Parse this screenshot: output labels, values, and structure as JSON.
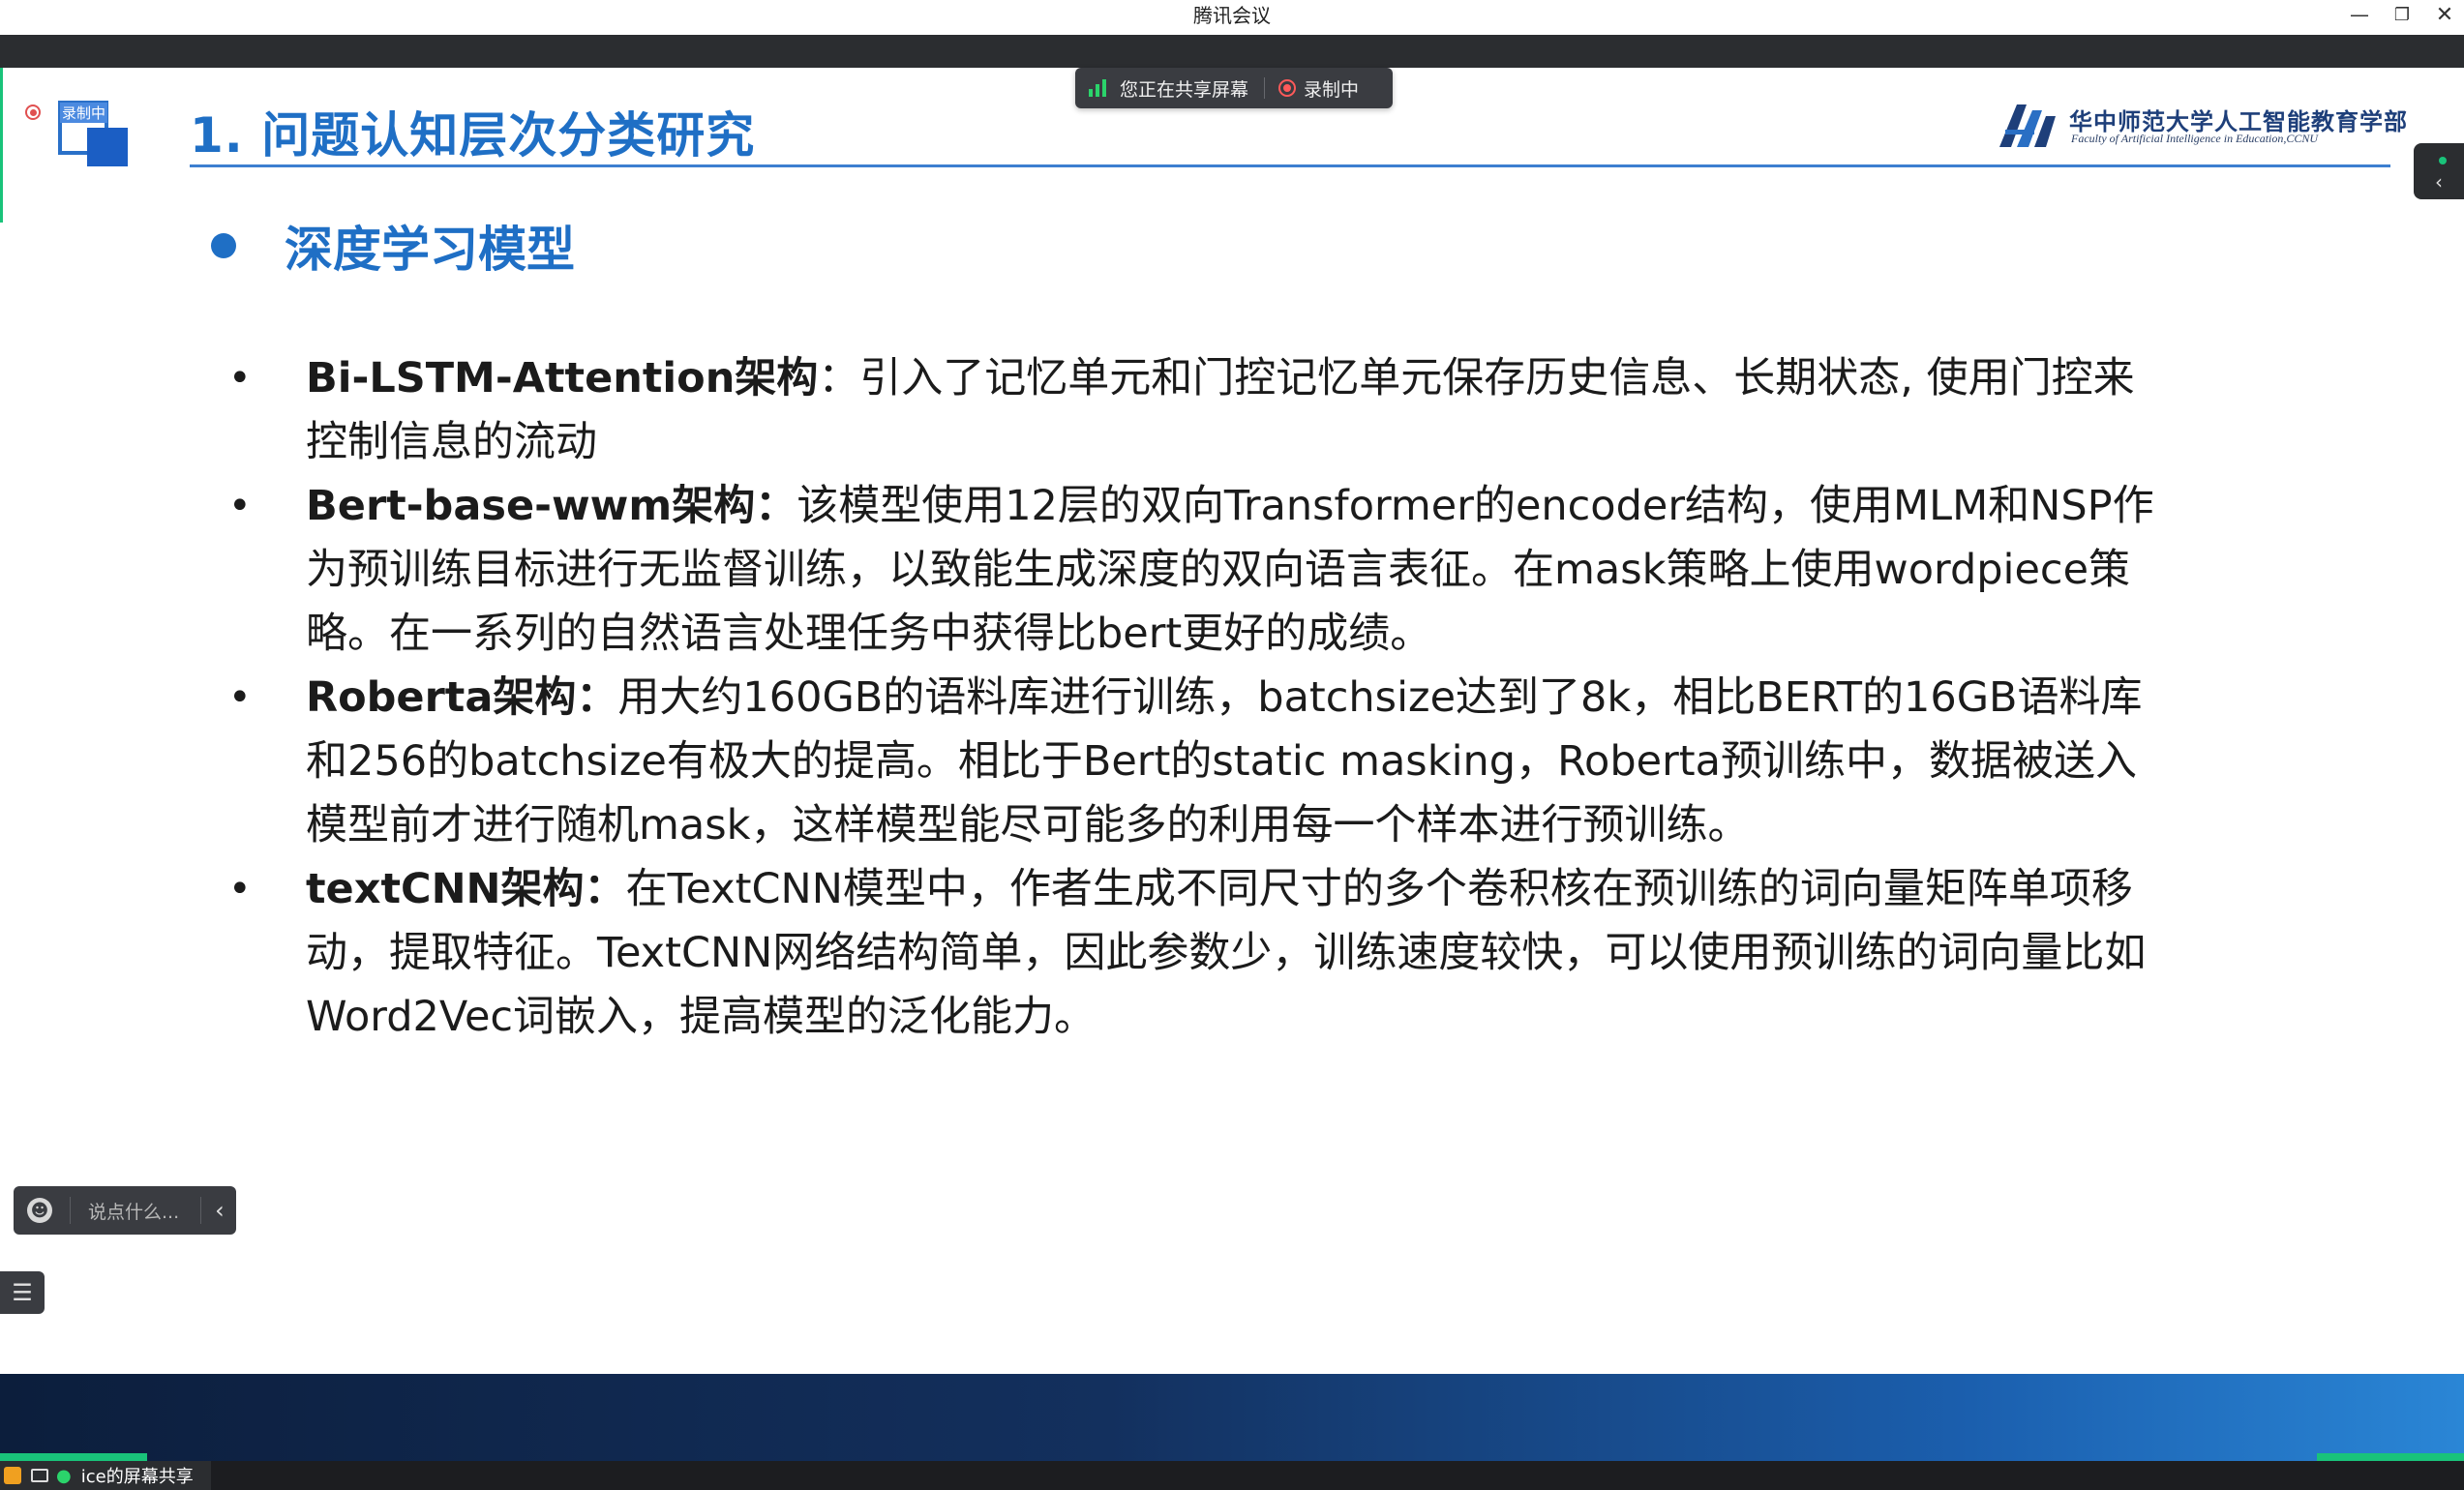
{
  "window": {
    "title": "腾讯会议",
    "minimize_glyph": "—",
    "restore_glyph": "❐",
    "close_glyph": "✕"
  },
  "share_toolbar": {
    "sharing_label": "您正在共享屏幕",
    "recording_label": "录制中"
  },
  "slide": {
    "logo_overlay_text": "录制中",
    "title": "1. 问题认知层次分类研究",
    "institution_cn": "华中师范大学人工智能教育学部",
    "institution_en": "Faculty of Artificial Intelligence in Education,CCNU",
    "section_heading": "深度学习模型",
    "items": [
      {
        "term": "Bi-LSTM-Attention架构",
        "text": "：引入了记忆单元和门控记忆单元保存历史信息、长期状态, 使用门控来控制信息的流动"
      },
      {
        "term": "Bert-base-wwm架构：",
        "text": "该模型使用12层的双向Transformer的encoder结构，使用MLM和NSP作为预训练目标进行无监督训练，以致能生成深度的双向语言表征。在mask策略上使用wordpiece策略。在一系列的自然语言处理任务中获得比bert更好的成绩。"
      },
      {
        "term": "Roberta架构：",
        "text": "用大约160GB的语料库进行训练，batchsize达到了8k，相比BERT的16GB语料库和256的batchsize有极大的提高。相比于Bert的static masking，Roberta预训练中，数据被送入模型前才进行随机mask，这样模型能尽可能多的利用每一个样本进行预训练。"
      },
      {
        "term": "textCNN架构：",
        "text": "在TextCNN模型中，作者生成不同尺寸的多个卷积核在预训练的词向量矩阵单项移动，提取特征。TextCNN网络结构简单，因此参数少，训练速度较快，可以使用预训练的词向量比如Word2Vec词嵌入，提高模型的泛化能力。"
      }
    ]
  },
  "chat": {
    "placeholder": "说点什么..."
  },
  "status_bar": {
    "label": "ice的屏幕共享"
  },
  "colors": {
    "accent_blue": "#1f6fc5",
    "tencent_green": "#19c37a",
    "toolbar_dark": "#3a3c41"
  }
}
